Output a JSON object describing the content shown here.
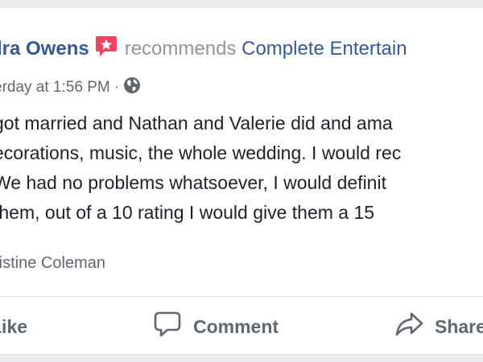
{
  "post": {
    "author_name": "dra Owens",
    "verb": "recommends",
    "page_name": "Complete Entertain",
    "timestamp": "erday at 1:56 PM ·",
    "privacy_icon": "globe-icon",
    "badge_icon": "recommendation-star-icon",
    "body_lines": [
      "got married and Nathan and Valerie did and ama",
      "ecorations, music, the whole wedding. I would rec",
      "We had no problems whatsoever, I would definit",
      "them, out of a 10 rating I would give them a 15"
    ],
    "tagged": "ristine Coleman"
  },
  "actions": {
    "like_label": "Like",
    "comment_label": "Comment",
    "share_label": "Share"
  },
  "colors": {
    "link": "#365899",
    "muted": "#90949c",
    "text": "#1d2129",
    "action": "#606770",
    "badge": "#f3425f"
  }
}
